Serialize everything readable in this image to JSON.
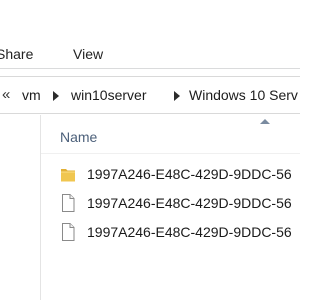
{
  "ribbon": {
    "tabs": [
      {
        "label": "Share"
      },
      {
        "label": "View"
      }
    ]
  },
  "address": {
    "overflow": "«",
    "crumbs": [
      "vm",
      "win10server",
      "Windows 10 Serv"
    ]
  },
  "filelist": {
    "column_name": "Name",
    "items": [
      {
        "name": "1997A246-E48C-429D-9DDC-56",
        "type": "folder"
      },
      {
        "name": "1997A246-E48C-429D-9DDC-56",
        "type": "file"
      },
      {
        "name": "1997A246-E48C-429D-9DDC-56",
        "type": "file"
      }
    ]
  },
  "colors": {
    "folder": "#f0c64f",
    "header_text": "#4c607a"
  }
}
